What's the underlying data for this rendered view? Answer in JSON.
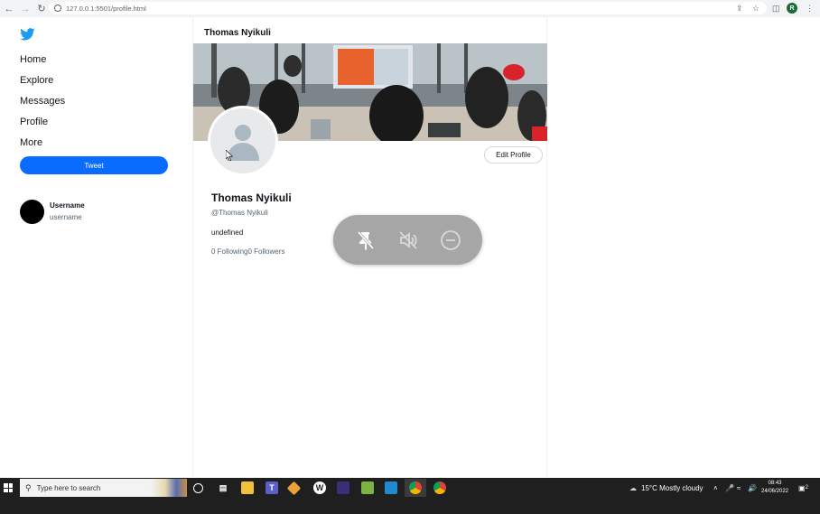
{
  "browser": {
    "url": "127.0.0.1:5501/profile.html",
    "profile_initial": "R"
  },
  "sidebar": {
    "items": [
      {
        "label": "Home"
      },
      {
        "label": "Explore"
      },
      {
        "label": "Messages"
      },
      {
        "label": "Profile"
      },
      {
        "label": "More"
      }
    ],
    "tweet_label": "Tweet",
    "account": {
      "username": "Username",
      "handle": "username"
    }
  },
  "main": {
    "title": "Thomas Nyikuli",
    "edit_label": "Edit Profile",
    "name": "Thomas Nyikuli",
    "handle": "@Thomas Nyikuli",
    "bio": "undefined",
    "following": "0 Following",
    "followers": "0 Followers"
  },
  "overlay": {
    "icons": [
      "pin-off-icon",
      "mute-icon",
      "minus-circle-icon"
    ]
  },
  "taskbar": {
    "search_placeholder": "Type here to search",
    "weather": "15°C  Mostly cloudy",
    "time": "08:43",
    "date": "24/06/2022",
    "notifications": "2"
  },
  "colors": {
    "brand": "#1d9bf0",
    "tweet_button": "#0a6bff",
    "overlay": "#a6a6a6"
  }
}
